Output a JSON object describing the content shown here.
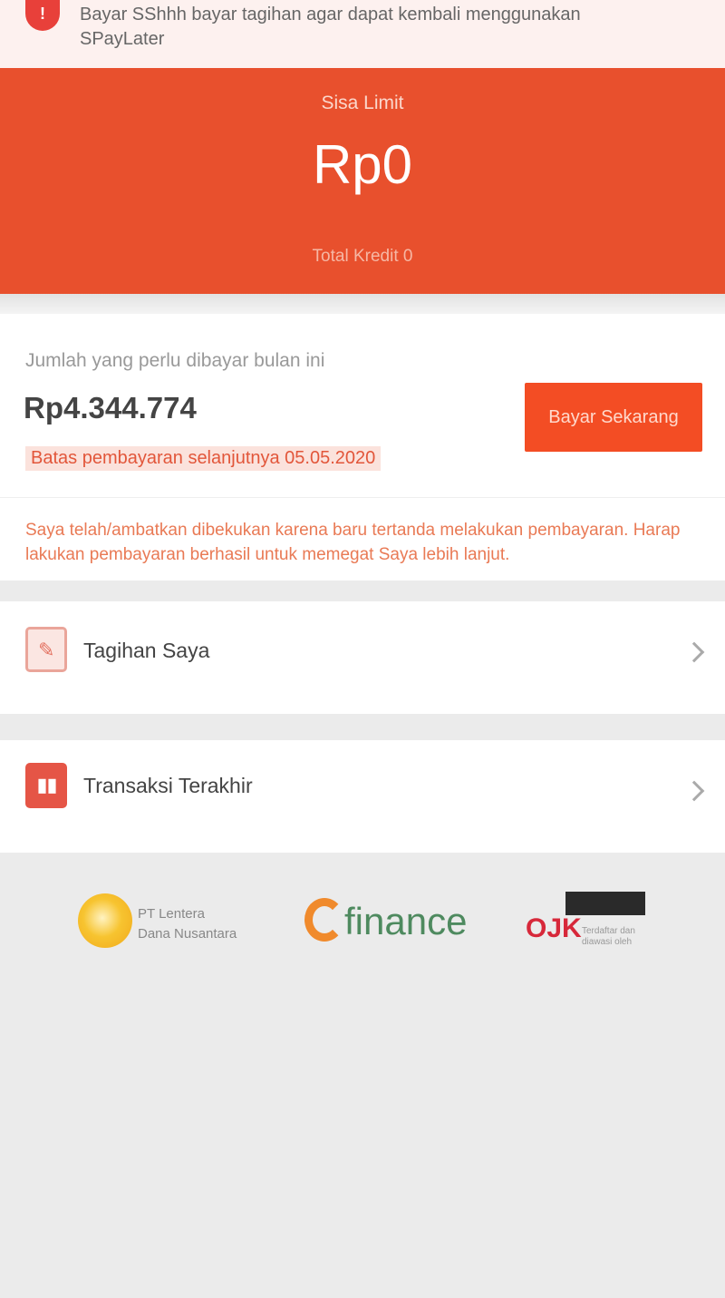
{
  "notice": {
    "icon_text": "!",
    "text": "Bayar SShhh bayar tagihan agar dapat kembali menggunakan SPayLater"
  },
  "hero": {
    "label": "Sisa Limit",
    "amount": "Rp0",
    "subtext": "Total Kredit 0"
  },
  "bill": {
    "label": "Jumlah yang perlu dibayar bulan ini",
    "amount": "Rp4.344.774",
    "pay_button": "Bayar Sekarang",
    "due_text": "Batas pembayaran selanjutnya 05.05.2020",
    "warning": "Saya telah/ambatkan dibekukan karena baru tertanda melakukan pembayaran. Harap lakukan pembayaran berhasil untuk memegat Saya lebih lanjut."
  },
  "menu": {
    "bills_label": "Tagihan Saya",
    "transactions_label": "Transaksi Terakhir"
  },
  "logos": {
    "partner_a_line1": "PT Lentera",
    "partner_a_line2": "Dana Nusantara",
    "partner_b": "finance",
    "partner_c": "OJK",
    "partner_c_sub_line1": "Terdaftar dan",
    "partner_c_sub_line2": "diawasi oleh"
  },
  "colors": {
    "brand": "#e8502d",
    "button": "#f34d24",
    "background": "#ebebeb"
  }
}
